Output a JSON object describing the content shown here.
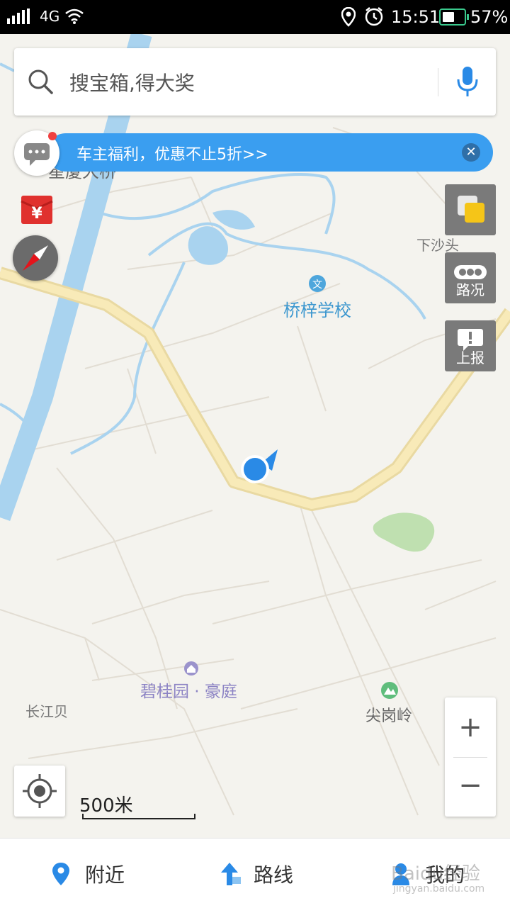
{
  "status": {
    "network": "4G",
    "time": "15:51",
    "battery": "57%",
    "battery_level": 0.57
  },
  "search": {
    "placeholder": "搜宝箱,得大奖"
  },
  "banner": {
    "text": "车主福利，优惠不止5折>>"
  },
  "side": {
    "traffic_label": "路况",
    "report_label": "上报"
  },
  "map_labels": {
    "bridge": "星厦大桥",
    "xiashatou": "下沙头",
    "school": "桥梓学校",
    "community": "碧桂园 · 豪庭",
    "changjiangbei": "长江贝",
    "jiangangling": "尖岗岭"
  },
  "scale": {
    "label": "500米"
  },
  "tabs": {
    "nearby": "附近",
    "route": "路线",
    "mine": "我的"
  },
  "watermark": {
    "main": "Baidu经验",
    "sub": "jingyan.baidu.com"
  },
  "colors": {
    "accent": "#3a9ef0",
    "road": "#f6e7b2",
    "river": "#a9d3ef",
    "park": "#bfe0b0"
  }
}
